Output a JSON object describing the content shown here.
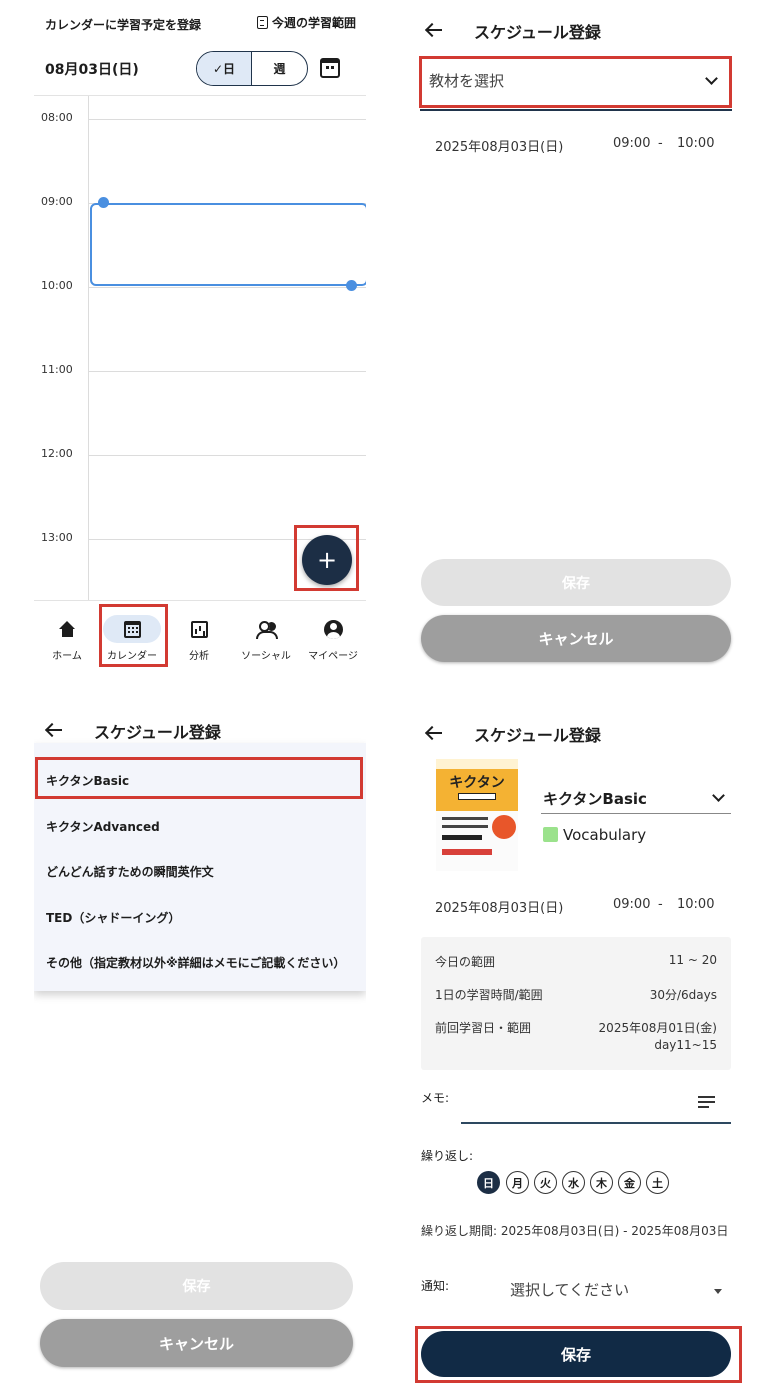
{
  "calendar_screen": {
    "header_title": "カレンダーに学習予定を登録",
    "header_link": "今週の学習範囲",
    "date": "08月03日(日)",
    "view_toggle": {
      "day": "✓日",
      "week": "週",
      "selected": "day"
    },
    "calendar_icon": "calendar-icon",
    "hours": [
      "08:00",
      "09:00",
      "10:00",
      "11:00",
      "12:00",
      "13:00"
    ],
    "selected_slot": {
      "start": "09:00",
      "end": "10:00"
    },
    "fab_label": "+",
    "accent_color": "#4a8fe0",
    "nav": [
      {
        "label": "ホーム",
        "icon": "home-icon"
      },
      {
        "label": "カレンダー",
        "icon": "calendar-icon",
        "active": true
      },
      {
        "label": "分析",
        "icon": "chart-icon"
      },
      {
        "label": "ソーシャル",
        "icon": "people-icon"
      },
      {
        "label": "マイページ",
        "icon": "account-icon"
      }
    ]
  },
  "schedule_empty": {
    "title": "スケジュール登録",
    "select_placeholder": "教材を選択",
    "date": "2025年08月03日(日)",
    "start_time": "09:00",
    "dash": "-",
    "end_time": "10:00",
    "save_label": "保存",
    "cancel_label": "キャンセル"
  },
  "schedule_dropdown": {
    "title": "スケジュール登録",
    "options": [
      "キクタンBasic",
      "キクタンAdvanced",
      "どんどん話すための瞬間英作文",
      "TED（シャドーイング）",
      "その他（指定教材以外※詳細はメモにご記載ください）"
    ],
    "save_label": "保存",
    "cancel_label": "キャンセル"
  },
  "schedule_filled": {
    "title": "スケジュール登録",
    "book": {
      "cover_title": "キクタン",
      "name": "キクタンBasic",
      "tag": "Vocabulary",
      "tag_color": "#9be28c"
    },
    "date": "2025年08月03日(日)",
    "start_time": "09:00",
    "dash": "-",
    "end_time": "10:00",
    "info": {
      "range_label": "今日の範囲",
      "range_value": "11 ~ 20",
      "daily_label": "1日の学習時間/範囲",
      "daily_value": "30分/6days",
      "prev_label": "前回学習日・範囲",
      "prev_date": "2025年08月01日(金)",
      "prev_range": "day11~15"
    },
    "memo_label": "メモ:",
    "repeat_label": "繰り返し:",
    "days": [
      "日",
      "月",
      "火",
      "水",
      "木",
      "金",
      "土"
    ],
    "selected_day": "日",
    "period_text": "繰り返し期間: 2025年08月03日(日) - 2025年08月03日",
    "notify_label": "通知:",
    "notify_value": "選択してください",
    "save_label": "保存",
    "primary_color": "#112a45"
  }
}
